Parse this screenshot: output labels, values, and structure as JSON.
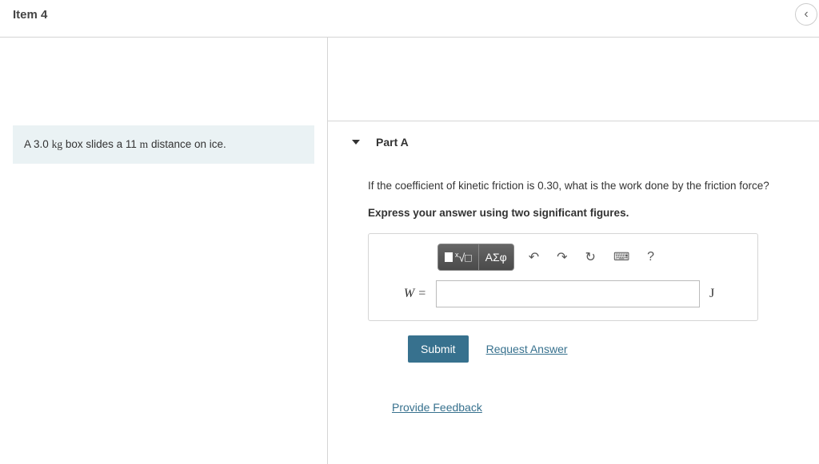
{
  "header": {
    "item_title": "Item 4"
  },
  "problem": {
    "mass": "3.0",
    "mass_unit": "kg",
    "verb": "box slides a",
    "distance": "11",
    "distance_unit": "m",
    "tail": "distance on ice."
  },
  "part": {
    "label": "Part A",
    "question": "If the coefficient of kinetic friction is 0.30, what is the work done by the friction force?",
    "instruction": "Express your answer using two significant figures.",
    "lhs": "W =",
    "unit": "J",
    "answer_value": ""
  },
  "toolbar": {
    "templates": "√",
    "greek": "ΑΣφ",
    "help": "?"
  },
  "actions": {
    "submit": "Submit",
    "request": "Request Answer"
  },
  "feedback": {
    "label": "Provide Feedback"
  }
}
